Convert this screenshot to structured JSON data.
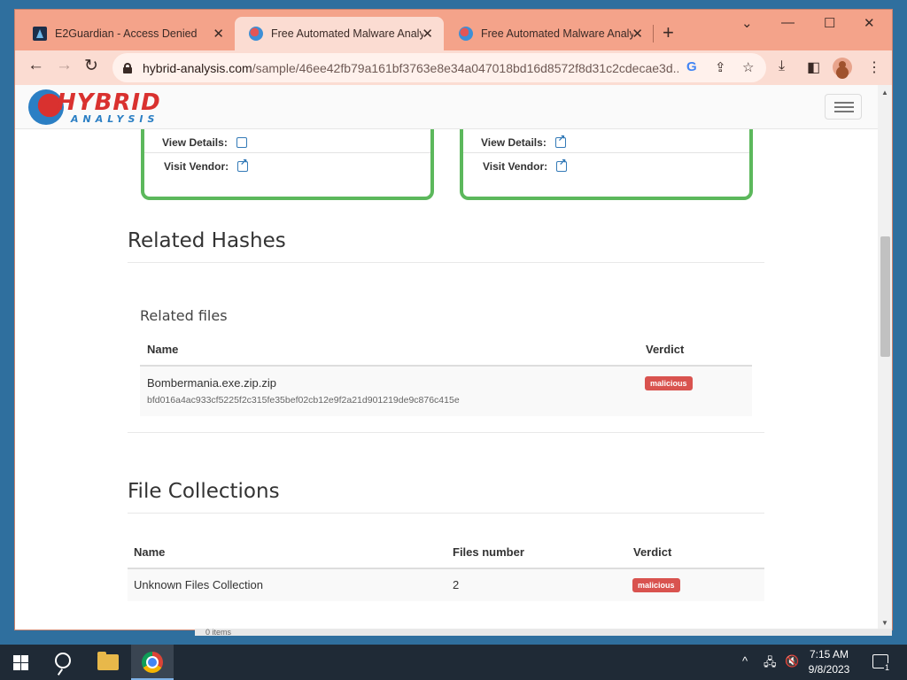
{
  "browser": {
    "tabs": [
      {
        "title": "E2Guardian - Access Denied",
        "favicon": "e2guardian-icon",
        "active": false
      },
      {
        "title": "Free Automated Malware Analysis",
        "favicon": "hybrid-analysis-icon",
        "active": true
      },
      {
        "title": "Free Automated Malware Analysis",
        "favicon": "hybrid-analysis-icon",
        "active": false
      }
    ],
    "url_host": "hybrid-analysis.com",
    "url_path": "/sample/46ee42fb79a161bf3763e8e34a047018bd16d8572f8d31c2cdecae3d..."
  },
  "site": {
    "logo_word": "HYBRID",
    "logo_sub": "ANALYSIS"
  },
  "vendor_cards": [
    {
      "view_details": "View Details:",
      "visit_vendor": "Visit Vendor:"
    },
    {
      "view_details": "View Details:",
      "visit_vendor": "Visit Vendor:"
    }
  ],
  "related_hashes": {
    "title": "Related Hashes",
    "subtitle": "Related files",
    "columns": [
      "Name",
      "Verdict"
    ],
    "rows": [
      {
        "name": "Bombermania.exe.zip.zip",
        "hash": "bfd016a4ac933cf5225f2c315fe35bef02cb12e9f2a21d901219de9c876c415e",
        "verdict": "malicious"
      }
    ]
  },
  "file_collections": {
    "title": "File Collections",
    "columns": [
      "Name",
      "Files number",
      "Verdict"
    ],
    "rows": [
      {
        "name": "Unknown Files Collection",
        "files_number": "2",
        "verdict": "malicious"
      }
    ]
  },
  "underlying_strip": "0 items",
  "taskbar": {
    "time": "7:15 AM",
    "date": "9/8/2023",
    "notification_count": "1"
  },
  "colors": {
    "verdict_malicious": "#d9534f",
    "card_border": "#5cb85c",
    "tab_strip": "#f4a38a"
  }
}
